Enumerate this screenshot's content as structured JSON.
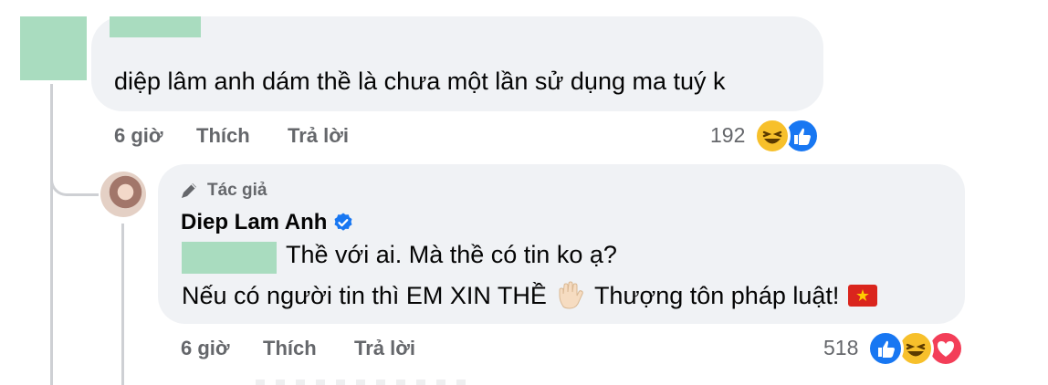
{
  "comment1": {
    "text": "diệp lâm anh dám thề là chưa một lần sử dụng ma tuý k",
    "time": "6 giờ",
    "like_label": "Thích",
    "reply_label": "Trả lời",
    "reaction_count": "192",
    "reactions": [
      "haha-icon",
      "like-icon"
    ]
  },
  "reply": {
    "author_badge": "Tác giả",
    "author_name": "Diep Lam Anh",
    "verified": true,
    "line1": "Thề với ai. Mà thề có tin ko ạ?",
    "line2_text": "Nếu có người tin thì EM XIN THỀ",
    "line2_emoji": "✋",
    "line2_after": "Thượng tôn pháp luật!",
    "flag": "vietnam-flag",
    "time": "6 giờ",
    "like_label": "Thích",
    "reply_label": "Trả lời",
    "reaction_count": "518",
    "reactions": [
      "like-icon",
      "haha-icon",
      "love-icon"
    ]
  },
  "colors": {
    "bubble": "#f0f2f5",
    "meta": "#65676b",
    "redaction": "#a9dcbf",
    "like": "#1877f2",
    "haha": "#f7c02b",
    "love": "#f33e58"
  }
}
